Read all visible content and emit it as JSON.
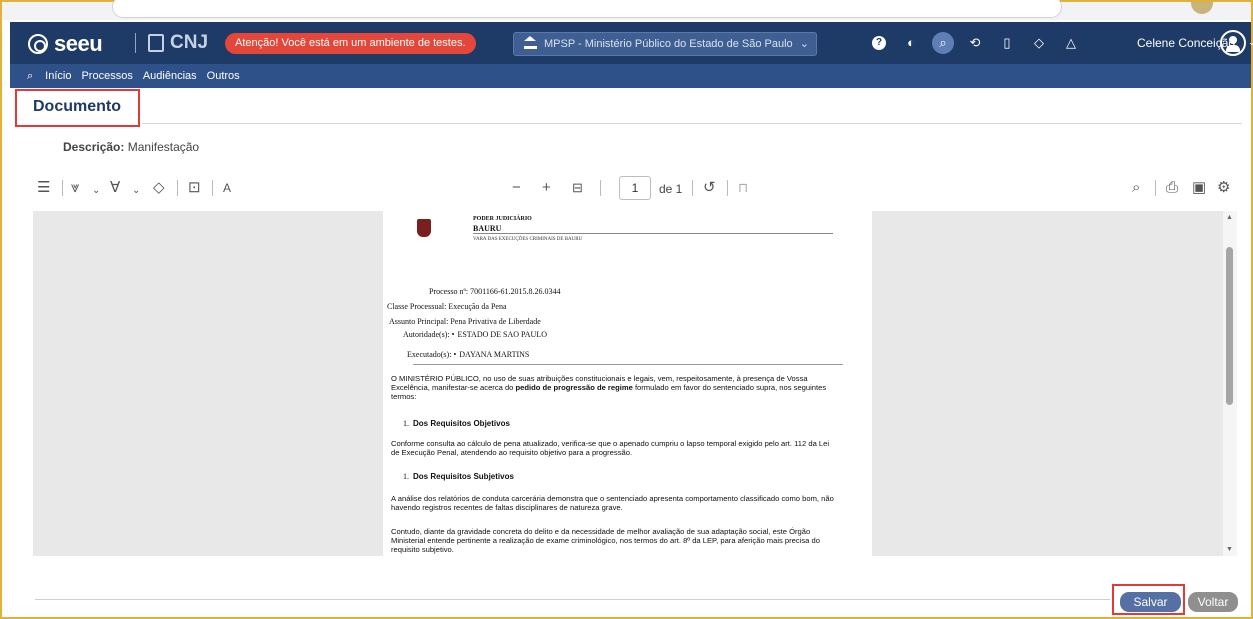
{
  "navbar": {
    "logo": "seeu",
    "cnj": "CNJ",
    "alert": "Atenção! Você está em um ambiente de testes.",
    "org_select": "MPSP - Ministério Público do Estado de São Paulo",
    "user_name": "Celene Conceição"
  },
  "menu": {
    "items": [
      "Início",
      "Processos",
      "Audiências",
      "Outros"
    ]
  },
  "page": {
    "title": "Documento",
    "description_label": "Descrição:",
    "description_value": "Manifestação"
  },
  "toolbar": {
    "current_page": "1",
    "page_of": "de 1"
  },
  "document": {
    "header_line1": "PODER JUDICIÁRIO",
    "header_line2": "BAURU",
    "header_line3": "VARA DAS EXECUÇÕES CRIMINAIS DE BAURU",
    "processo_label": "Processo nº:",
    "processo_value": "7001166-61.2015.8.26.0344",
    "classe_label": "Classe Processual:",
    "classe_value": "Execução da Pena",
    "assunto_label": "Assunto Principal:",
    "assunto_value": "Pena Privativa de Liberdade",
    "autoridade_label": "Autoridade(s):",
    "autoridade_value": "ESTADO DE SAO PAULO",
    "executado_label": "Executado(s):",
    "executado_value": "DAYANA MARTINS",
    "intro_pre": "O MINISTÉRIO PÚBLICO, no uso de suas atribuições constitucionais e legais, vem, respeitosamente, à presença de Vossa Excelência, manifestar-se acerca do ",
    "intro_bold": "pedido de progressão de regime",
    "intro_post": " formulado em favor do sentenciado supra, nos seguintes termos:",
    "section1_num": "1.",
    "section1_title": "Dos Requisitos Objetivos",
    "section1_text": "Conforme consulta ao cálculo de pena atualizado, verifica-se que o apenado cumpriu o lapso temporal exigido pelo art. 112 da Lei de Execução Penal, atendendo ao requisito objetivo para a progressão.",
    "section2_num": "1.",
    "section2_title": "Dos Requisitos Subjetivos",
    "section2_text1": "A análise dos relatórios de conduta carcerária demonstra que o sentenciado apresenta comportamento classificado como bom, não havendo registros recentes de faltas disciplinares de natureza grave.",
    "section2_text2": "Contudo, diante da gravidade concreta do delito e da necessidade de melhor avaliação de sua adaptação social, este Órgão Ministerial entende pertinente a realização de exame criminológico, nos termos do art. 8º da LEP, para aferição mais precisa do requisito subjetivo."
  },
  "footer": {
    "save_label": "Salvar",
    "back_label": "Voltar"
  },
  "colors": {
    "navbar": "#1e3a66",
    "menubar": "#2f5189",
    "alert": "#e2473a",
    "save": "#5470a5",
    "highlight": "#e03a3a"
  }
}
